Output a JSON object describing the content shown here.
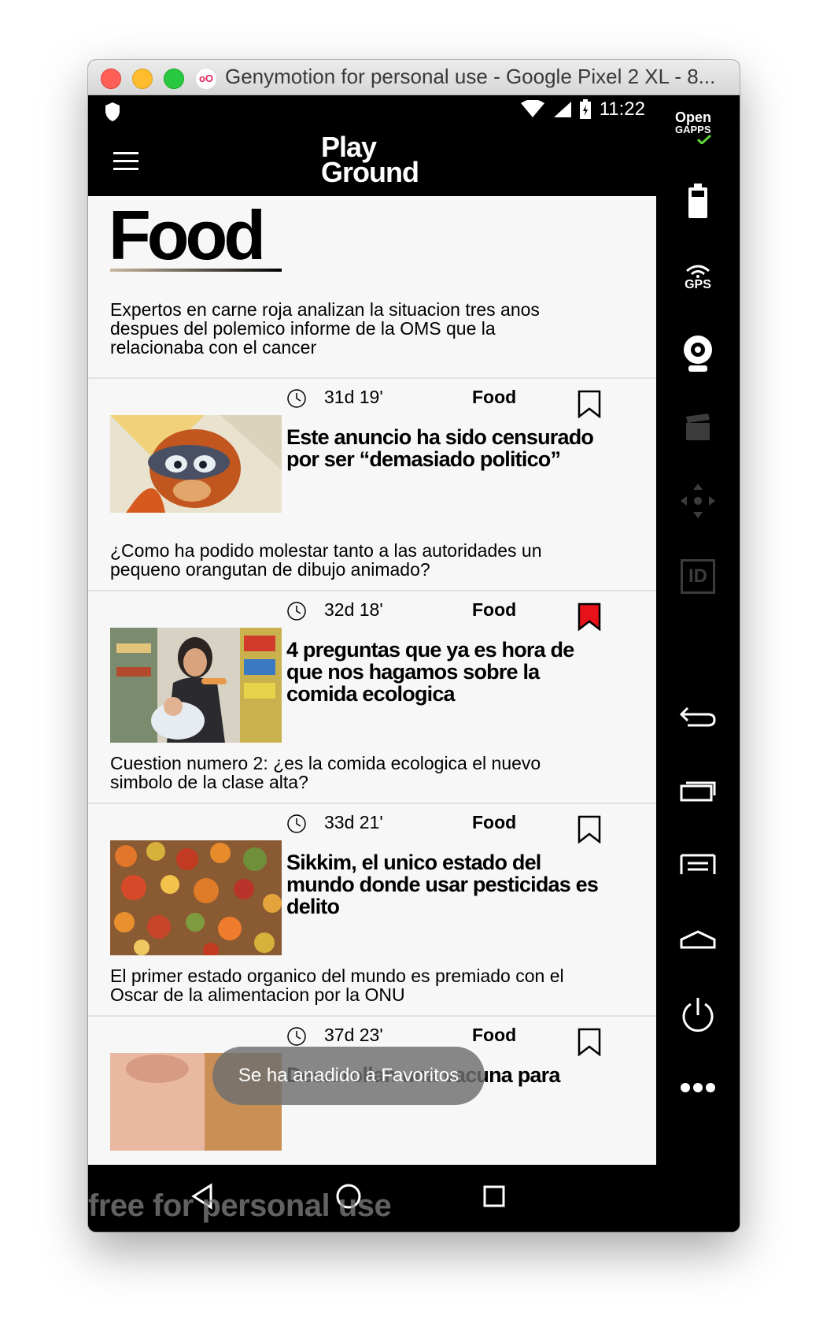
{
  "window": {
    "title": "Genymotion for personal use - Google Pixel 2 XL - 8...",
    "logo_text": "oO"
  },
  "status_bar": {
    "time": "11:22"
  },
  "app": {
    "logo_line1": "Play",
    "logo_line2": "Ground",
    "section_title": "Food",
    "intro": "Expertos en carne roja analizan la situacion tres anos despues del polemico informe de la OMS que la relacionaba con el cancer"
  },
  "articles": [
    {
      "time": "31d 19'",
      "category": "Food",
      "headline": "Este anuncio ha sido censurado por ser “demasiado politico”",
      "description": "¿Como ha podido molestar tanto a las autoridades un pequeno orangutan de dibujo animado?",
      "bookmarked": false
    },
    {
      "time": "32d 18'",
      "category": "Food",
      "headline": "4 preguntas que ya es hora de que nos hagamos sobre la comida ecologica",
      "description": "Cuestion numero 2: ¿es la comida ecologica el nuevo simbolo de la clase alta?",
      "bookmarked": true
    },
    {
      "time": "33d 21'",
      "category": "Food",
      "headline": "Sikkim, el unico estado del mundo donde usar pesticidas es delito",
      "description": "El primer estado organico del mundo es premiado con el Oscar de la alimentacion por la ONU",
      "bookmarked": false
    },
    {
      "time": "37d 23'",
      "category": "Food",
      "headline": "Desarrollan una vacuna para",
      "bookmarked": false
    }
  ],
  "toast": "Se ha anadido a Favoritos",
  "watermark": "free for personal use",
  "sidebar": {
    "opengapps_line1": "Open",
    "opengapps_line2": "GAPPS",
    "gps_label": "GPS",
    "id_label": "ID"
  },
  "colors": {
    "bookmark_active": "#e8121b",
    "content_bg": "#f7f7f7"
  }
}
